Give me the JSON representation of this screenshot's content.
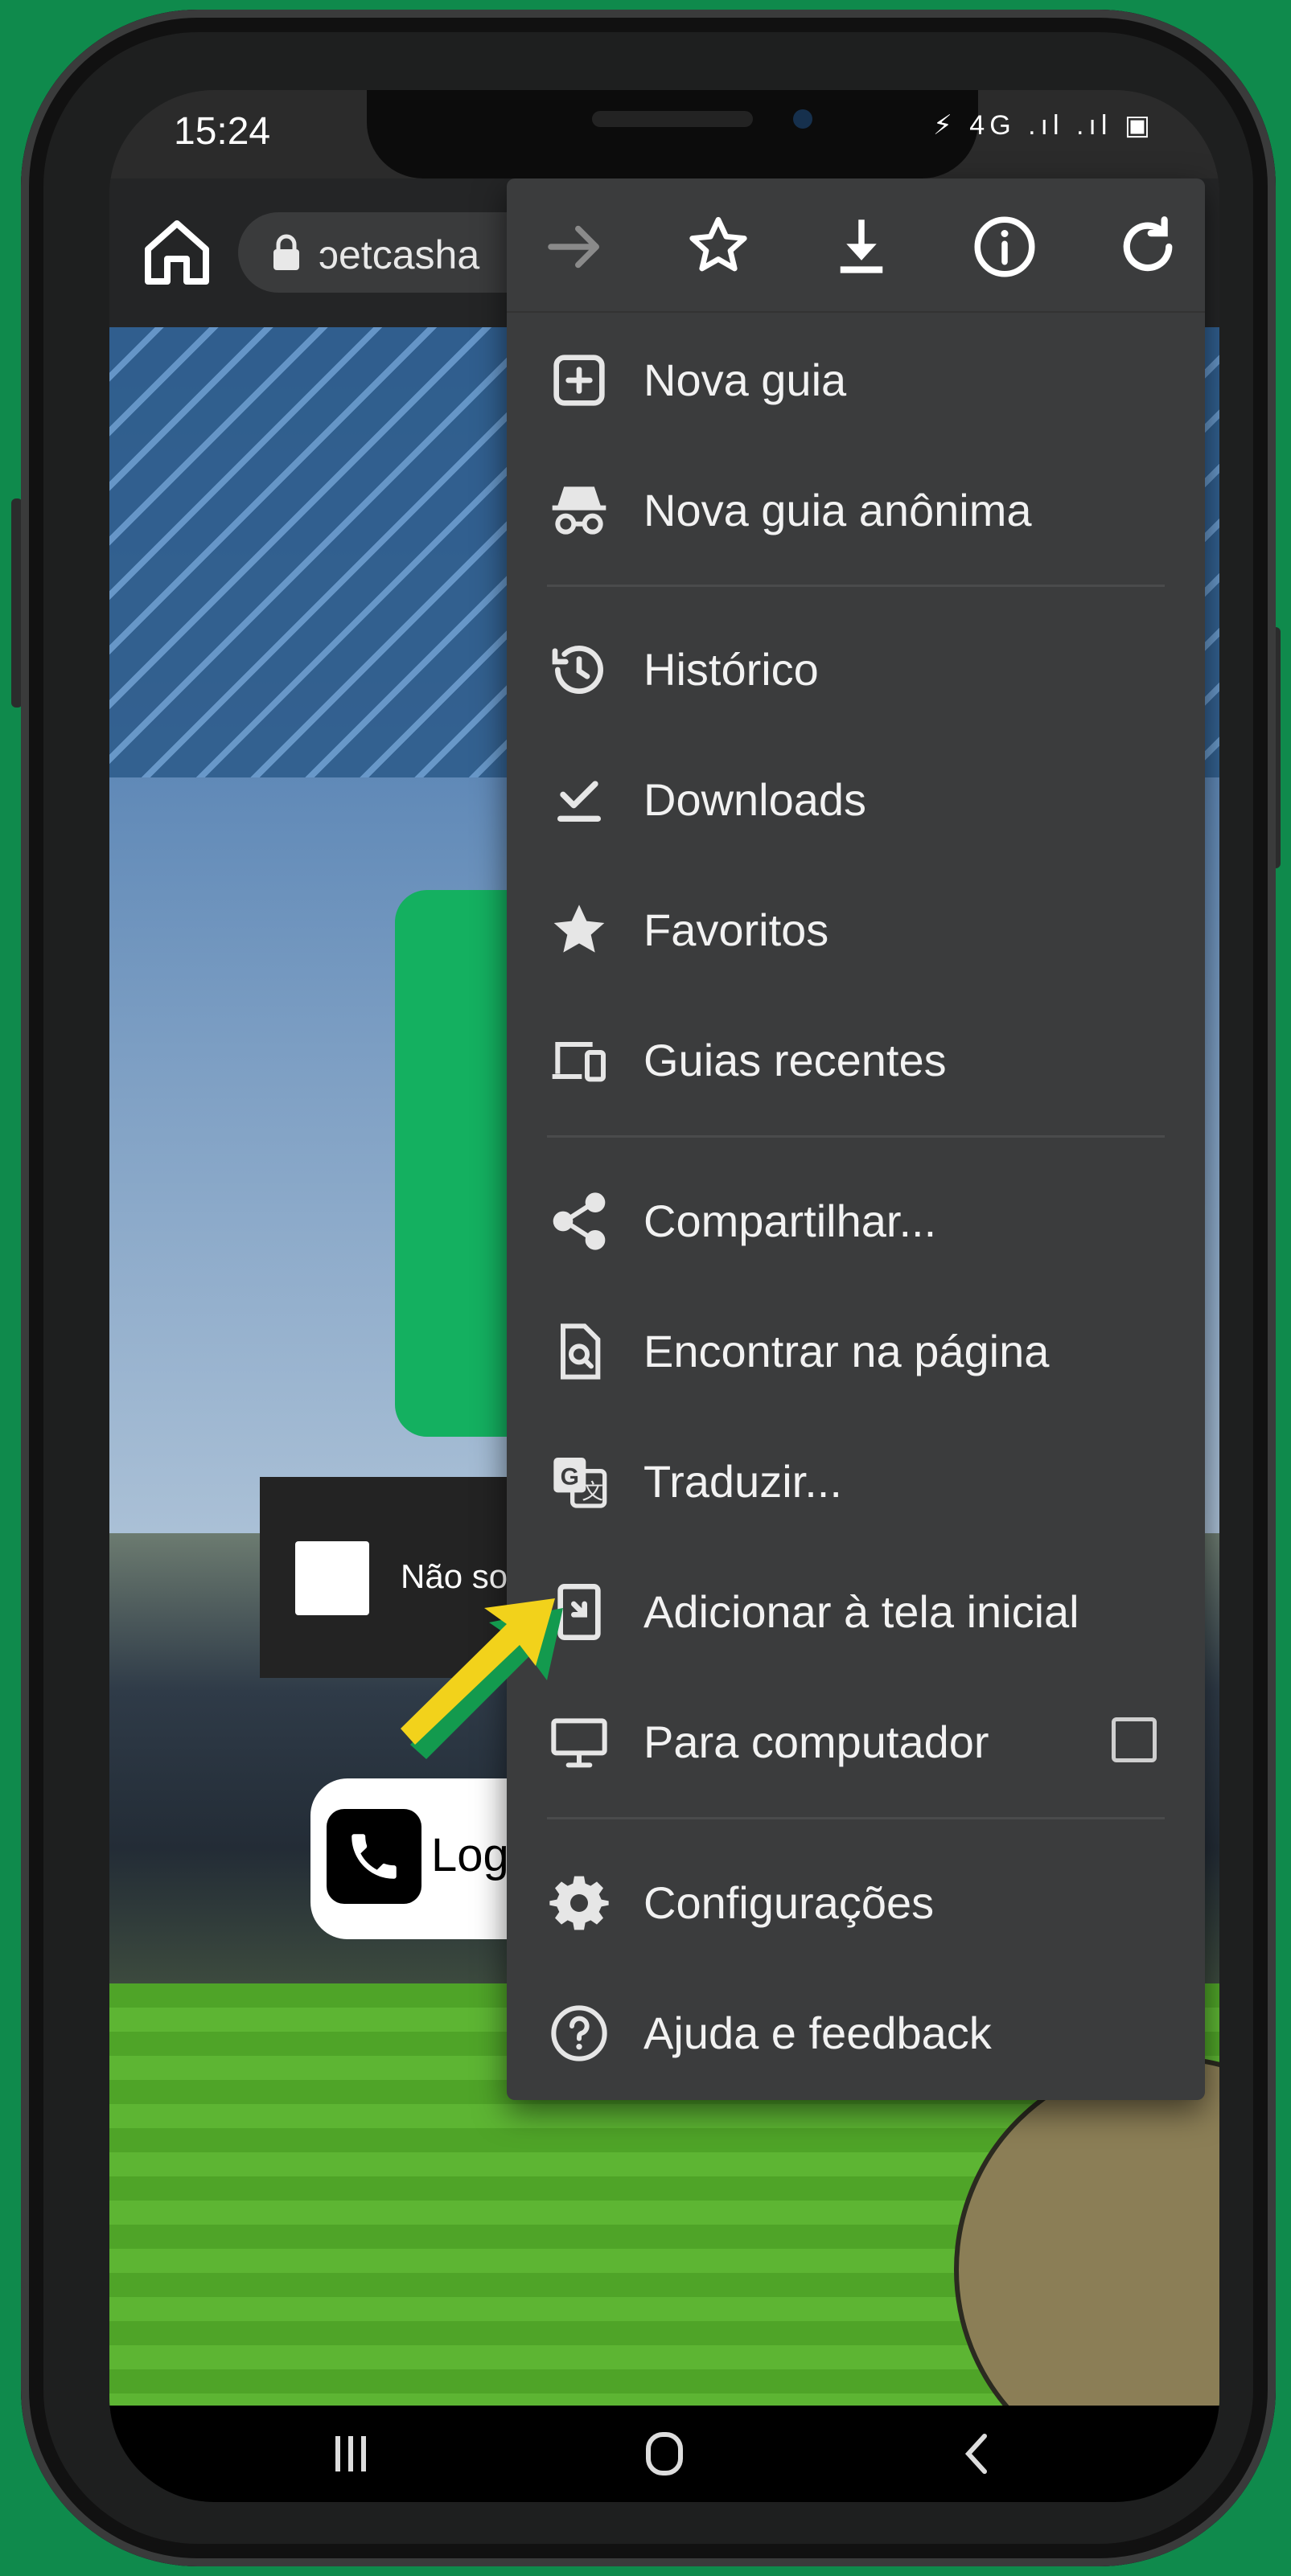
{
  "status_bar": {
    "time": "15:24",
    "icons": "⚡ 4G .ıl .ıl ▣"
  },
  "toolbar": {
    "url_text": "ɔetcasha"
  },
  "webpage": {
    "captcha_label": "Não so",
    "whatsapp_label": "Log"
  },
  "menu": {
    "items": [
      {
        "label": "Nova guia",
        "icon": "new-tab-icon"
      },
      {
        "label": "Nova guia anônima",
        "icon": "incognito-icon"
      },
      {
        "label": "Histórico",
        "icon": "history-icon"
      },
      {
        "label": "Downloads",
        "icon": "downloads-icon"
      },
      {
        "label": "Favoritos",
        "icon": "star-icon"
      },
      {
        "label": "Guias recentes",
        "icon": "devices-icon"
      },
      {
        "label": "Compartilhar...",
        "icon": "share-icon"
      },
      {
        "label": "Encontrar na página",
        "icon": "find-icon"
      },
      {
        "label": "Traduzir...",
        "icon": "translate-icon"
      },
      {
        "label": "Adicionar à tela inicial",
        "icon": "add-home-icon"
      },
      {
        "label": "Para computador",
        "icon": "desktop-icon"
      },
      {
        "label": "Configurações",
        "icon": "settings-icon"
      },
      {
        "label": "Ajuda e feedback",
        "icon": "help-icon"
      }
    ],
    "desktop_site_checked": false
  },
  "colors": {
    "background_green": "#0f8a4c",
    "menu_bg": "#3b3c3d",
    "arrow_yellow": "#f2d21b",
    "arrow_green": "#139a4e"
  }
}
